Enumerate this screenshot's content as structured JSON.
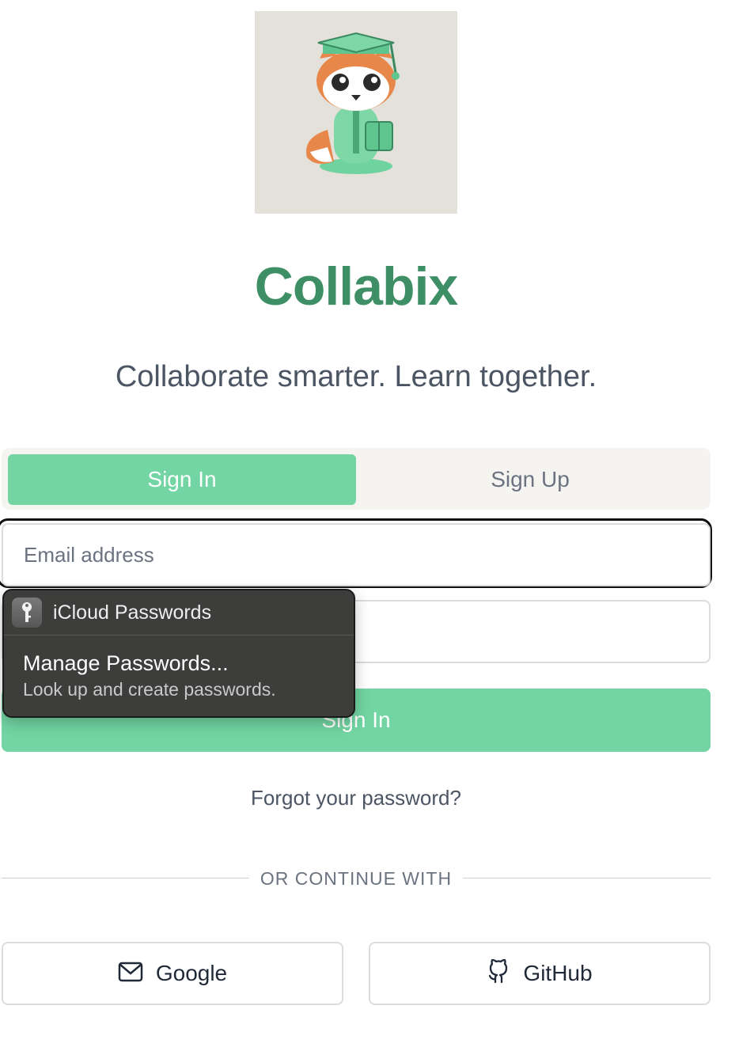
{
  "brand": {
    "name": "Collabix",
    "tagline": "Collaborate smarter. Learn together.",
    "accent_color": "#3f8f66",
    "button_color": "#72d5a3",
    "logo_icon": "fox-graduate-mascot-icon"
  },
  "tabs": [
    {
      "label": "Sign In",
      "active": true
    },
    {
      "label": "Sign Up",
      "active": false
    }
  ],
  "form": {
    "email_placeholder": "Email address",
    "email_value": "",
    "password_placeholder": "",
    "password_value": "",
    "submit_label": "Sign In",
    "forgot_label": "Forgot your password?"
  },
  "divider": {
    "label": "OR CONTINUE WITH"
  },
  "oauth": {
    "google": {
      "label": "Google",
      "icon": "mail-icon"
    },
    "github": {
      "label": "GitHub",
      "icon": "github-icon"
    }
  },
  "password_popup": {
    "title": "iCloud Passwords",
    "icon": "key-icon",
    "item_title": "Manage Passwords...",
    "item_subtitle": "Look up and create passwords."
  }
}
